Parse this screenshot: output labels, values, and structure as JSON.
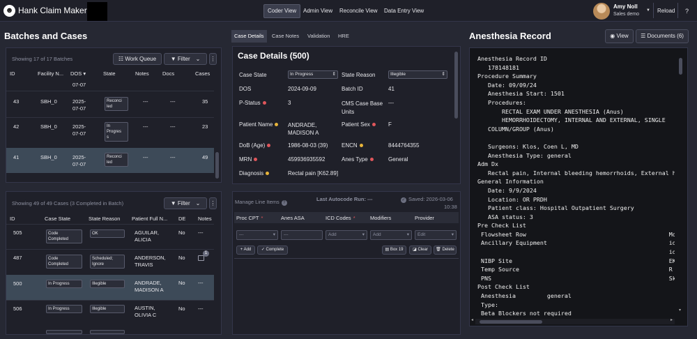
{
  "header": {
    "app_title": "Hank Claim Maker",
    "nav": [
      "Coder View",
      "Admin View",
      "Reconcile View",
      "Data Entry View"
    ],
    "active_nav": "Coder View",
    "user_name": "Amy Noll",
    "user_sub": "Sales demo",
    "reload_label": "Reload",
    "help_label": "?"
  },
  "left": {
    "title": "Batches and Cases",
    "batches": {
      "showing": "Showing 17 of 17 Batches",
      "work_queue_label": "Work Queue",
      "filter_label": "Filter",
      "columns": [
        "ID",
        "Facility N...",
        "DOS",
        "State",
        "Notes",
        "Docs",
        "Cases"
      ],
      "partial_row": {
        "dos": "07-07"
      },
      "rows": [
        {
          "id": "43",
          "facility": "SBH_0",
          "dos": [
            "2025-",
            "07-07"
          ],
          "state": [
            "Reconci",
            "led"
          ],
          "notes": "---",
          "docs": "---",
          "cases": "35"
        },
        {
          "id": "42",
          "facility": "SBH_0",
          "dos": [
            "2025-",
            "07-07"
          ],
          "state": [
            "In",
            "Progres",
            "s"
          ],
          "notes": "---",
          "docs": "---",
          "cases": "23"
        },
        {
          "id": "41",
          "facility": "SBH_0",
          "dos": [
            "2025-",
            "07-07"
          ],
          "state": [
            "Reconci",
            "led"
          ],
          "notes": "---",
          "docs": "---",
          "cases": "49"
        }
      ]
    },
    "cases": {
      "showing": "Showing 49 of 49 Cases (3 Completed in Batch)",
      "filter_label": "Filter",
      "columns": [
        "ID",
        "Case State",
        "State Reason",
        "Patient Full N...",
        "DE",
        "Notes"
      ],
      "rows": [
        {
          "id": "505",
          "state": [
            "Code",
            "Completed"
          ],
          "reason": [
            "OK"
          ],
          "patient": [
            "AGUILAR,",
            "ALICIA"
          ],
          "de": "No",
          "notes": "---"
        },
        {
          "id": "487",
          "state": [
            "Code",
            "Completed"
          ],
          "reason": [
            "Scheduled;",
            "Ignore"
          ],
          "patient": [
            "ANDERSON,",
            "TRAVIS"
          ],
          "de": "No",
          "notes": "",
          "badge": "1"
        },
        {
          "id": "500",
          "state": [
            "In Progress"
          ],
          "reason": [
            "Illegible"
          ],
          "patient": [
            "ANDRADE,",
            "MADISON A"
          ],
          "de": "No",
          "notes": "---"
        },
        {
          "id": "506",
          "state": [
            "In Progress"
          ],
          "reason": [
            "Illegible"
          ],
          "patient": [
            "AUSTIN,",
            "OLIVIA C"
          ],
          "de": "No",
          "notes": "---"
        }
      ]
    }
  },
  "middle": {
    "tabs": [
      "Case Details",
      "Case Notes",
      "Validation",
      "HRE"
    ],
    "active_tab": "Case Details",
    "details_title": "Case Details (500)",
    "case_state_label": "Case State",
    "case_state_value": "In Progress",
    "state_reason_label": "State Reason",
    "state_reason_value": "Illegible",
    "fields": [
      {
        "l": "DOS",
        "v": "2024-09-09",
        "l2": "Batch ID",
        "v2": "41"
      },
      {
        "l": "P-Status",
        "dot": "r",
        "v": "3",
        "l2": "CMS Case Base Units",
        "v2": "---"
      },
      {
        "l": "Patient Name",
        "dot": "y",
        "v": "ANDRADE, MADISON A",
        "l2": "Patient Sex",
        "dot2": "r",
        "v2": "F"
      },
      {
        "l": "DoB (Age)",
        "dot": "r",
        "v": "1986-08-03 (39)",
        "l2": "ENCN",
        "dot2": "y",
        "v2": "8444764355"
      },
      {
        "l": "MRN",
        "dot": "r",
        "v": "459936935592",
        "l2": "Anes Type",
        "dot2": "r",
        "v2": "General"
      },
      {
        "l": "Diagnosis",
        "dot": "y",
        "v": "Rectal pain [K62.89]",
        "l2": "",
        "v2": ""
      }
    ],
    "line_items": {
      "title": "Manage Line Items",
      "last_autocode": "Last Autocode Run: ---",
      "saved": "Saved: 2026-03-06",
      "saved_time": "10:38",
      "columns": [
        "Proc CPT",
        "Anes ASA",
        "ICD Codes",
        "Modifiers",
        "Provider"
      ],
      "inputs": [
        "---",
        "---",
        "Add",
        "Add",
        "Edit"
      ],
      "buttons": {
        "add": "+ Add",
        "complete": "✓ Complete",
        "box": "Box 19",
        "clear": "Clear",
        "delete": "Delete"
      }
    }
  },
  "right": {
    "title": "Anesthesia Record",
    "view_label": "View",
    "documents_label": "Documents (6)",
    "lines": [
      "Anesthesia Record ID",
      "   178148181",
      "Procedure Summary",
      "   Date: 09/09/24",
      "   Anesthesia Start: 1501",
      "   Procedures:",
      "       RECTAL EXAM UNDER ANESTHESIA (Anus)",
      "       HEMORRHOIDECTOMY, INTERNAL AND EXTERNAL, SINGLE",
      "   COLUMN/GROUP (Anus)",
      "",
      "   Surgeons: Klos, Coen L, MD",
      "   Anesthesia Type: general",
      "Adm Dx",
      "   Rectal pain, Internal bleeding hemorrhoids, External h",
      "General Information",
      "   Date: 9/9/2024",
      "   Location: OR PRDH",
      "   Patient class: Hospital Outpatient Surgery",
      "   ASA status: 3",
      "Pre Check List",
      " Flowsheet Row                                         Most",
      " Ancillary Equipment                                   ider",
      "                                                       iden",
      " NIBP Site                                             EKG",
      " Temp Source                                           R up",
      " PNS                                                   Skin",
      "Post Check List",
      " Anesthesia         general",
      " Type:",
      " Beta Blockers not required"
    ]
  }
}
